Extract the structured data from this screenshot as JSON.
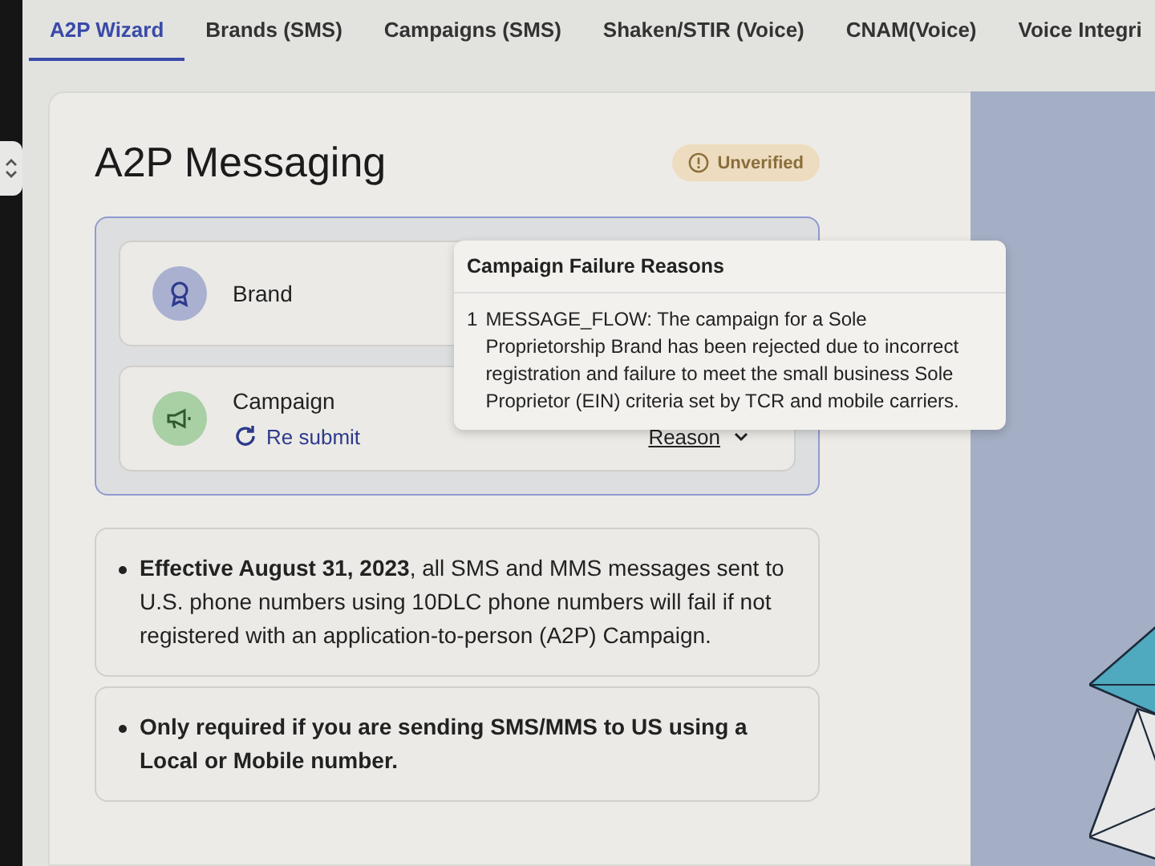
{
  "tabs": [
    {
      "label": "A2P Wizard",
      "selected": true
    },
    {
      "label": "Brands (SMS)",
      "selected": false
    },
    {
      "label": "Campaigns (SMS)",
      "selected": false
    },
    {
      "label": "Shaken/STIR (Voice)",
      "selected": false
    },
    {
      "label": "CNAM(Voice)",
      "selected": false
    },
    {
      "label": "Voice Integri",
      "selected": false
    }
  ],
  "title": "A2P Messaging",
  "status": {
    "label": "Unverified"
  },
  "steps": [
    {
      "kind": "brand",
      "label": "Brand"
    },
    {
      "kind": "campaign",
      "label": "Campaign",
      "action": "Re submit",
      "reason_link": "Reason"
    }
  ],
  "tooltip": {
    "title": "Campaign Failure Reasons",
    "items": [
      {
        "number": "1",
        "text": "MESSAGE_FLOW: The campaign for a Sole Proprietorship Brand has been rejected due to incorrect registration and failure to meet the small business Sole Proprietor (EIN) criteria set by TCR and mobile carriers."
      }
    ]
  },
  "notices": [
    {
      "text": "**Effective August 31, 2023**, all SMS and MMS messages sent to U.S. phone numbers using 10DLC phone numbers will fail if not registered with an application-to-person (A2P) Campaign.",
      "bold": false
    },
    {
      "text": "Only required if you are sending SMS/MMS to US using a Local or Mobile number.",
      "bold": true
    }
  ]
}
